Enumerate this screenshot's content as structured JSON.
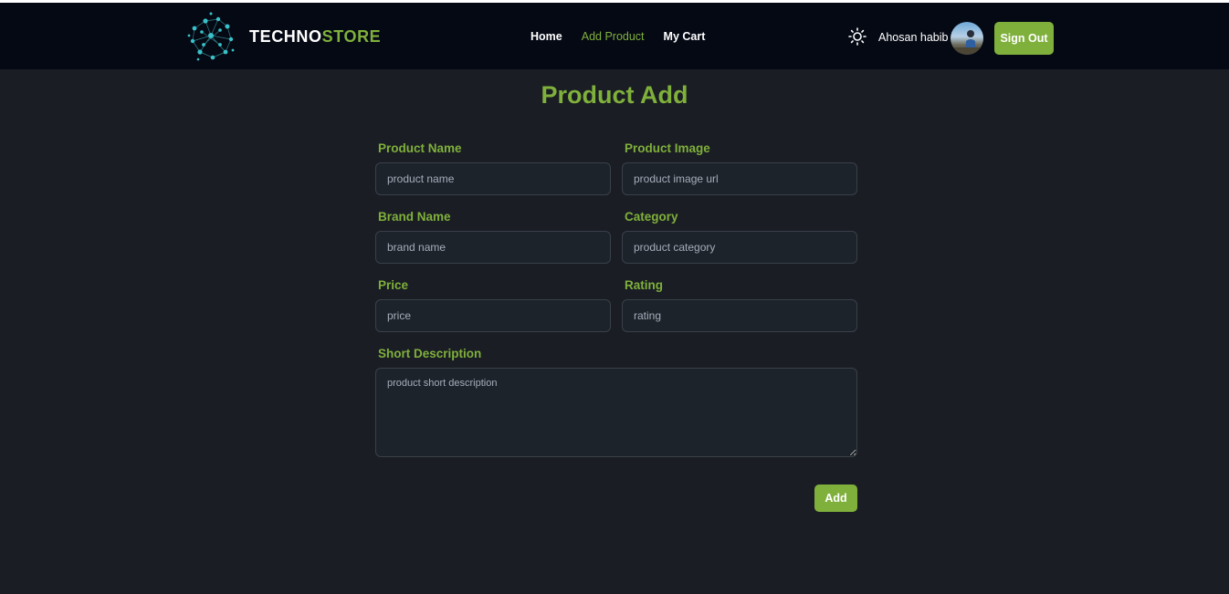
{
  "navbar": {
    "brand_part1": "TECHNO",
    "brand_part2": "STORE",
    "links": [
      {
        "label": "Home",
        "active": false
      },
      {
        "label": "Add Product",
        "active": true
      },
      {
        "label": "My Cart",
        "active": false
      }
    ],
    "theme_icon": "sun-icon",
    "username": "Ahosan habib",
    "signout_label": "Sign Out"
  },
  "form": {
    "title": "Product Add",
    "fields": {
      "product_name": {
        "label": "Product Name",
        "placeholder": "product name",
        "value": ""
      },
      "product_image": {
        "label": "Product Image",
        "placeholder": "product image url",
        "value": ""
      },
      "brand_name": {
        "label": "Brand Name",
        "placeholder": "brand name",
        "value": ""
      },
      "category": {
        "label": "Category",
        "placeholder": "product category",
        "value": ""
      },
      "price": {
        "label": "Price",
        "placeholder": "price",
        "value": ""
      },
      "rating": {
        "label": "Rating",
        "placeholder": "rating",
        "value": ""
      },
      "short_description": {
        "label": "Short Description",
        "placeholder": "product short description",
        "value": ""
      }
    },
    "submit_label": "Add"
  },
  "colors": {
    "accent": "#7fb03b",
    "navbar_bg": "#050914",
    "page_bg": "#1a1d24",
    "input_bg": "#1d232a",
    "input_border": "#3a4049"
  }
}
